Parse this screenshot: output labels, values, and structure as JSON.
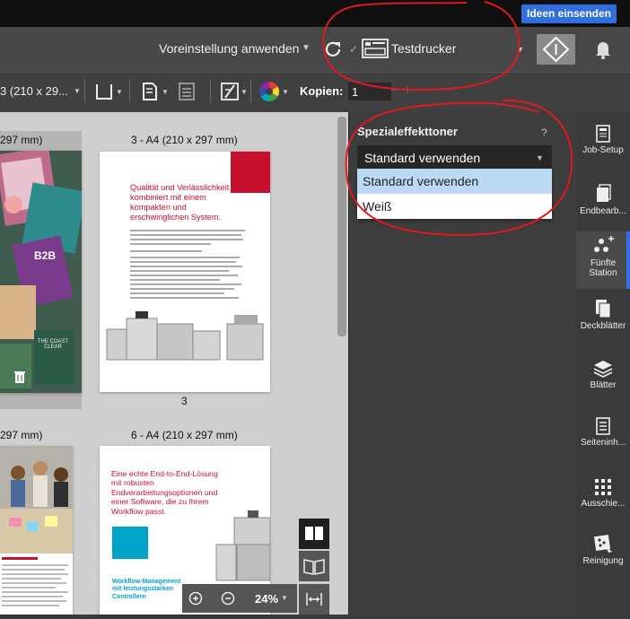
{
  "topbar": {
    "ideen_label": "Ideen einsenden"
  },
  "header": {
    "preset_label": "Voreinstellung anwenden",
    "printer_name": "Testdrucker"
  },
  "toolbar": {
    "paper_size": "3 (210 x 29...",
    "copies_label": "Kopien:",
    "copies_value": "1",
    "minus": "−",
    "plus": "+"
  },
  "pages": [
    {
      "label": "297 mm)"
    },
    {
      "label": "3 - A4 (210 x 297 mm)",
      "number": "3",
      "headline": "Qualität und Verlässlichkeit kombiniert mit einem kompakten und erschwinglichen System."
    },
    {
      "label": "297 mm)"
    },
    {
      "label": "6 - A4 (210 x 297 mm)",
      "headline": "Eine echte End-to-End-Lösung mit robusten Endverarbeitungsoptionen und einer Software, die zu Ihrem Workflow passt.",
      "subhead": "Workflow-Management mit leistungsstarken Controllern"
    }
  ],
  "thumb_left_titles": {
    "b2b": "B2B",
    "coast": "THE COAST CLEAR"
  },
  "panel": {
    "title": "Spezialeffekttoner",
    "help": "?",
    "selected": "Standard verwenden",
    "options": [
      "Standard verwenden",
      "Weiß"
    ]
  },
  "sidenav": [
    {
      "label": "Job-Setup",
      "icon": "job-setup-icon"
    },
    {
      "label": "Endbearb...",
      "icon": "finishing-icon"
    },
    {
      "label": "Fünfte Station",
      "icon": "fifth-station-icon"
    },
    {
      "label": "Deckblätter",
      "icon": "covers-icon"
    },
    {
      "label": "Blätter",
      "icon": "sheets-icon"
    },
    {
      "label": "Seiteninh...",
      "icon": "page-content-icon"
    },
    {
      "label": "Ausschie...",
      "icon": "imposition-icon"
    },
    {
      "label": "Reinigung",
      "icon": "cleaning-icon"
    }
  ],
  "zoom": {
    "level": "24%"
  },
  "colors": {
    "accent": "#2f6fe0",
    "annotation": "#e0191f",
    "brand_red": "#c8102e"
  }
}
